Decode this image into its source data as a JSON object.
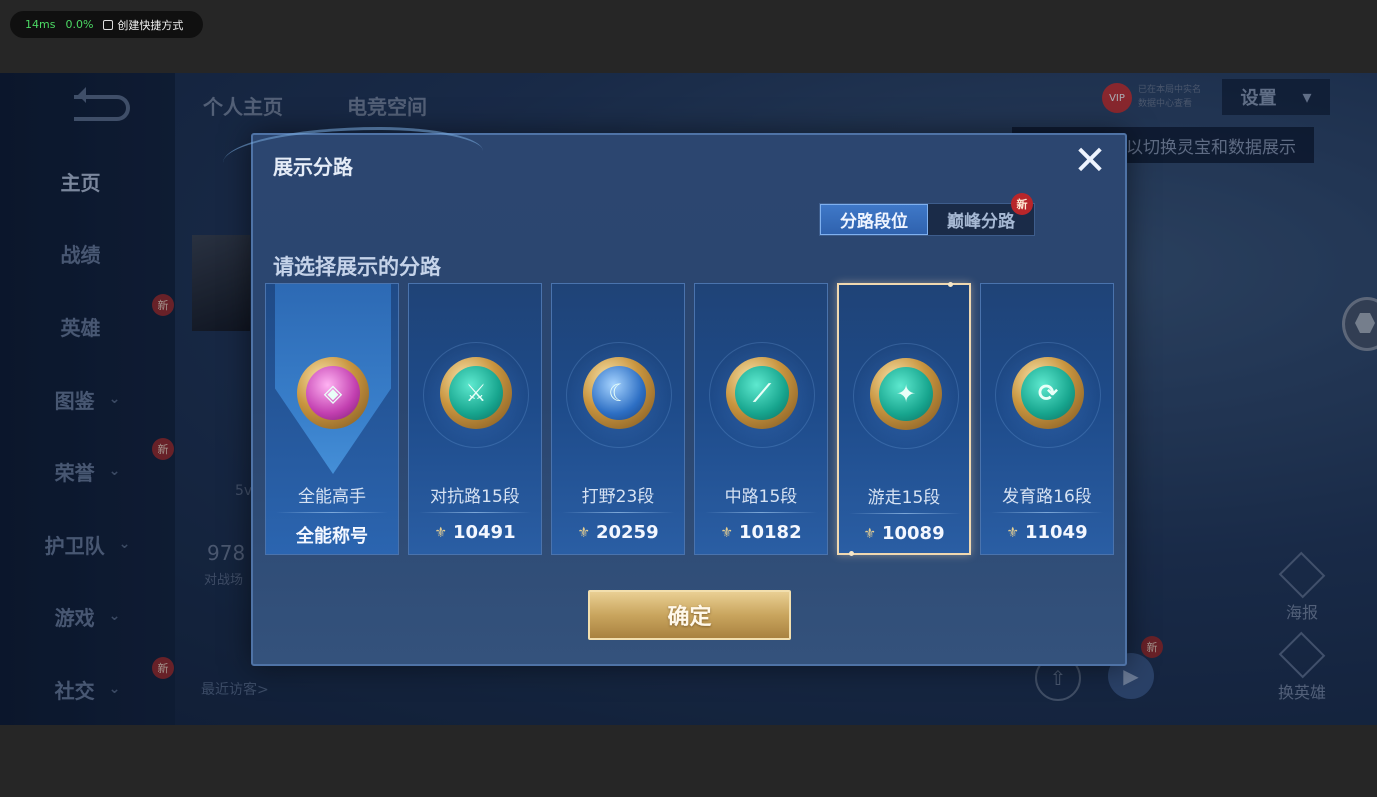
{
  "perf": {
    "latency": "14ms",
    "loss": "0.0%",
    "shortcut_label": "创建快捷方式"
  },
  "background": {
    "tabs": [
      "个人主页",
      "电竞空间"
    ],
    "nav": [
      {
        "label": "主页",
        "chevron": "",
        "active": true
      },
      {
        "label": "战绩",
        "chevron": ""
      },
      {
        "label": "英雄",
        "chevron": ""
      },
      {
        "label": "图鉴",
        "chevron": "⌄"
      },
      {
        "label": "荣誉",
        "chevron": "⌄"
      },
      {
        "label": "护卫队",
        "chevron": "⌄"
      },
      {
        "label": "游戏",
        "chevron": "⌄"
      },
      {
        "label": "社交",
        "chevron": "⌄"
      }
    ],
    "new_badge": "新",
    "settings_label": "设置",
    "vip_label": "VIP",
    "vip_text_1": "已在本局中实名",
    "vip_text_2": "数据中心查看",
    "hint_text": "以切换灵宝和数据展示",
    "number_partial": "978",
    "sub_partial": "对战场",
    "five_partial": "5v",
    "visitors_label": "最近访客>",
    "side_btn_1": "海报",
    "side_btn_2": "换英雄"
  },
  "dialog": {
    "title": "展示分路",
    "close_glyph": "✕",
    "tabs": {
      "active": "分路段位",
      "other": "巅峰分路"
    },
    "tab_new": "新",
    "prompt": "请选择展示的分路",
    "cards": [
      {
        "label": "全能高手",
        "value": "全能称号",
        "badge": "purple",
        "glyph": "◈",
        "selected": false
      },
      {
        "label": "对抗路15段",
        "value": "10491",
        "badge": "teal",
        "glyph": "⚔",
        "selected": false
      },
      {
        "label": "打野23段",
        "value": "20259",
        "badge": "blue",
        "glyph": "☾",
        "selected": false
      },
      {
        "label": "中路15段",
        "value": "10182",
        "badge": "teal",
        "glyph": "⟋",
        "selected": false
      },
      {
        "label": "游走15段",
        "value": "10089",
        "badge": "teal",
        "glyph": "✦",
        "selected": true
      },
      {
        "label": "发育路16段",
        "value": "11049",
        "badge": "teal",
        "glyph": "⟳",
        "selected": false
      }
    ],
    "confirm_label": "确定"
  },
  "colors": {
    "accent_gold": "#c9a55e",
    "tab_active": "#2f62ae",
    "panel": "#2c4670"
  }
}
